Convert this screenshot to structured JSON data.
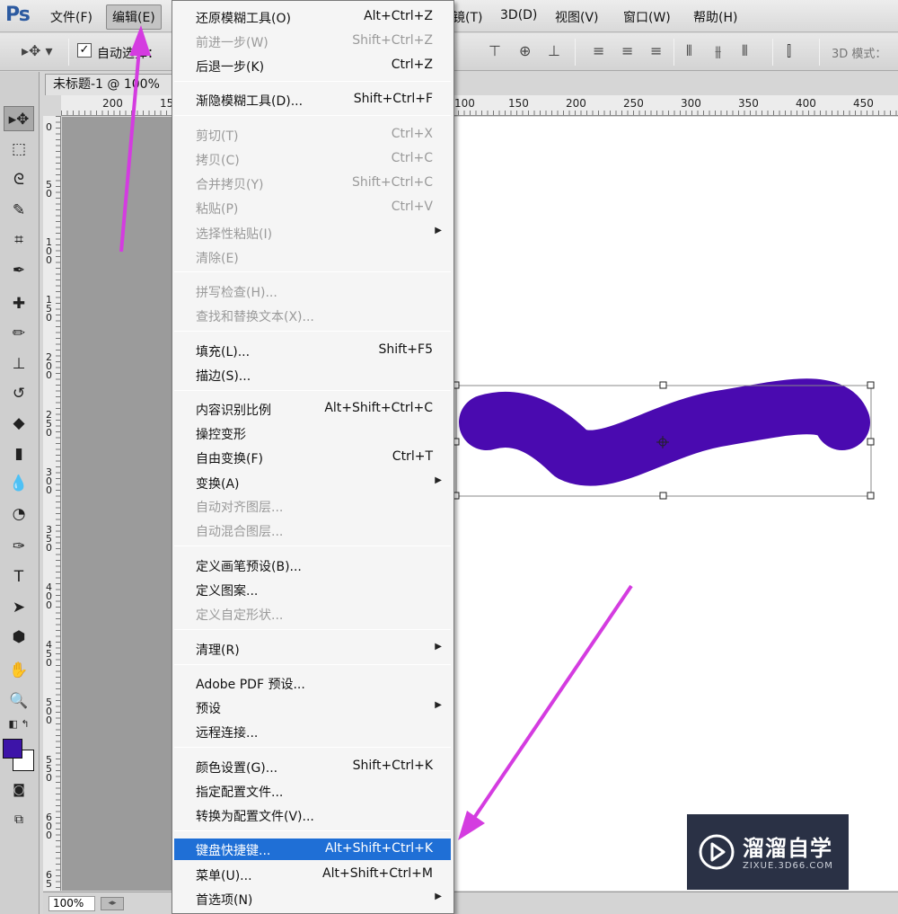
{
  "app": {
    "logo": "Ps"
  },
  "menubar": {
    "items": [
      {
        "label": "文件(F)"
      },
      {
        "label": "编辑(E)"
      },
      {
        "label": "镜(T)"
      },
      {
        "label": "3D(D)"
      },
      {
        "label": "视图(V)"
      },
      {
        "label": "窗口(W)"
      },
      {
        "label": "帮助(H)"
      }
    ]
  },
  "options": {
    "auto_select_label": "自动选择：",
    "checked": true,
    "mode_label": "3D 模式："
  },
  "document": {
    "tab_title": "未标题-1 @ 100%",
    "zoom": "100%"
  },
  "ruler_top": [
    "200",
    "15",
    "100",
    "150",
    "200",
    "250",
    "300",
    "350",
    "400",
    "450"
  ],
  "ruler_left": [
    "0",
    "5 0",
    "1 0 0",
    "1 5 0",
    "2 0 0",
    "2 5 0",
    "3 0 0",
    "3 5 0",
    "4 0 0",
    "4 5 0",
    "5 0 0",
    "5 5 0",
    "6 0 0",
    "6 5"
  ],
  "colors": {
    "foreground": "#3d14a8",
    "background": "#ffffff",
    "stroke": "#4a0ab0",
    "highlight": "#1f6fd6",
    "arrow": "#d43ce0"
  },
  "edit_menu": {
    "items": [
      {
        "label": "还原模糊工具(O)",
        "shortcut": "Alt+Ctrl+Z"
      },
      {
        "label": "前进一步(W)",
        "shortcut": "Shift+Ctrl+Z"
      },
      {
        "label": "后退一步(K)",
        "shortcut": "Ctrl+Z"
      },
      {
        "label": "渐隐模糊工具(D)...",
        "shortcut": "Shift+Ctrl+F"
      },
      {
        "label": "剪切(T)",
        "shortcut": "Ctrl+X"
      },
      {
        "label": "拷贝(C)",
        "shortcut": "Ctrl+C"
      },
      {
        "label": "合并拷贝(Y)",
        "shortcut": "Shift+Ctrl+C"
      },
      {
        "label": "粘贴(P)",
        "shortcut": "Ctrl+V"
      },
      {
        "label": "选择性粘贴(I)",
        "shortcut": ""
      },
      {
        "label": "清除(E)",
        "shortcut": ""
      },
      {
        "label": "拼写检查(H)...",
        "shortcut": ""
      },
      {
        "label": "查找和替换文本(X)...",
        "shortcut": ""
      },
      {
        "label": "填充(L)...",
        "shortcut": "Shift+F5"
      },
      {
        "label": "描边(S)...",
        "shortcut": ""
      },
      {
        "label": "内容识别比例",
        "shortcut": "Alt+Shift+Ctrl+C"
      },
      {
        "label": "操控变形",
        "shortcut": ""
      },
      {
        "label": "自由变换(F)",
        "shortcut": "Ctrl+T"
      },
      {
        "label": "变换(A)",
        "shortcut": ""
      },
      {
        "label": "自动对齐图层...",
        "shortcut": ""
      },
      {
        "label": "自动混合图层...",
        "shortcut": ""
      },
      {
        "label": "定义画笔预设(B)...",
        "shortcut": ""
      },
      {
        "label": "定义图案...",
        "shortcut": ""
      },
      {
        "label": "定义自定形状...",
        "shortcut": ""
      },
      {
        "label": "清理(R)",
        "shortcut": ""
      },
      {
        "label": "Adobe PDF 预设...",
        "shortcut": ""
      },
      {
        "label": "预设",
        "shortcut": ""
      },
      {
        "label": "远程连接...",
        "shortcut": ""
      },
      {
        "label": "颜色设置(G)...",
        "shortcut": "Shift+Ctrl+K"
      },
      {
        "label": "指定配置文件...",
        "shortcut": ""
      },
      {
        "label": "转换为配置文件(V)...",
        "shortcut": ""
      },
      {
        "label": "键盘快捷键...",
        "shortcut": "Alt+Shift+Ctrl+K"
      },
      {
        "label": "菜单(U)...",
        "shortcut": "Alt+Shift+Ctrl+M"
      },
      {
        "label": "首选项(N)",
        "shortcut": ""
      }
    ]
  },
  "watermark": {
    "brand": "溜溜自学",
    "url": "ZIXUE.3D66.COM"
  }
}
